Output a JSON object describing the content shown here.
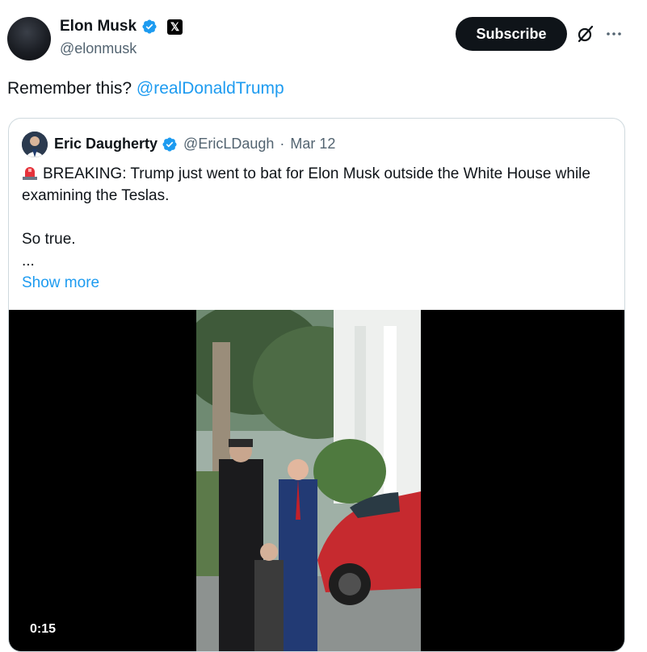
{
  "author": {
    "name": "Elon Musk",
    "handle": "@elonmusk",
    "verified_color": "#1d9bf0",
    "affiliate_badge": "𝕏"
  },
  "actions": {
    "subscribe_label": "Subscribe",
    "grok_icon": "slashed-circle-icon",
    "more_icon": "more-icon"
  },
  "tweet": {
    "text": "Remember this? ",
    "mention": "@realDonaldTrump"
  },
  "quote": {
    "author_name": "Eric Daugherty",
    "author_handle": "@EricLDaugh",
    "separator": "·",
    "date": "Mar 12",
    "line1": "BREAKING: Trump just went to bat for Elon Musk outside the White House while examining the Teslas.",
    "line2": "So true.",
    "line3": "...",
    "show_more": "Show more",
    "siren_icon": "siren-emoji-icon",
    "video": {
      "duration": "0:15"
    }
  },
  "colors": {
    "link": "#1d9bf0",
    "secondary_text": "#536471",
    "border": "#cfd9de"
  }
}
